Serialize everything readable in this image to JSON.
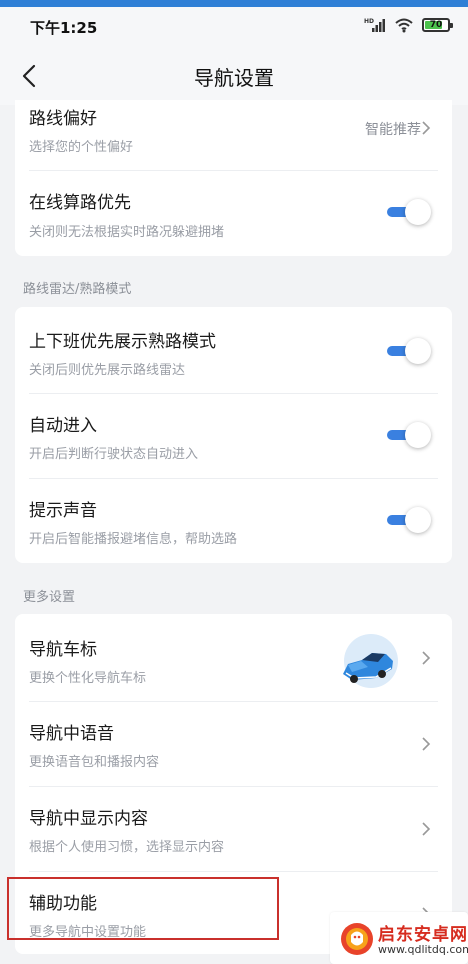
{
  "status_bar": {
    "time": "下午1:25",
    "signal_badge": "HD",
    "battery_level": "70"
  },
  "nav": {
    "title": "导航设置"
  },
  "route_section": {
    "preference": {
      "title": "路线偏好",
      "subtitle": "选择您的个性偏好",
      "value": "智能推荐"
    },
    "online_calc": {
      "title": "在线算路优先",
      "subtitle": "关闭则无法根据实时路况躲避拥堵",
      "enabled": true
    }
  },
  "radar_section": {
    "label": "路线雷达/熟路模式",
    "items": [
      {
        "title": "上下班优先展示熟路模式",
        "subtitle": "关闭后则优先展示路线雷达",
        "enabled": true
      },
      {
        "title": "自动进入",
        "subtitle": "开启后判断行驶状态自动进入",
        "enabled": true
      },
      {
        "title": "提示声音",
        "subtitle": "开启后智能播报避堵信息，帮助选路",
        "enabled": true
      }
    ]
  },
  "more_section": {
    "label": "更多设置",
    "items": [
      {
        "title": "导航车标",
        "subtitle": "更换个性化导航车标"
      },
      {
        "title": "导航中语音",
        "subtitle": "更换语音包和播报内容"
      },
      {
        "title": "导航中显示内容",
        "subtitle": "根据个人使用习惯，选择显示内容"
      },
      {
        "title": "辅助功能",
        "subtitle": "更多导航中设置功能"
      }
    ]
  },
  "watermark": {
    "name": "启东安卓网",
    "url": "www.qdlitdq.com"
  },
  "colors": {
    "accent": "#3a80e0",
    "highlight_border": "#c9302c",
    "background": "#f2f3f5"
  }
}
